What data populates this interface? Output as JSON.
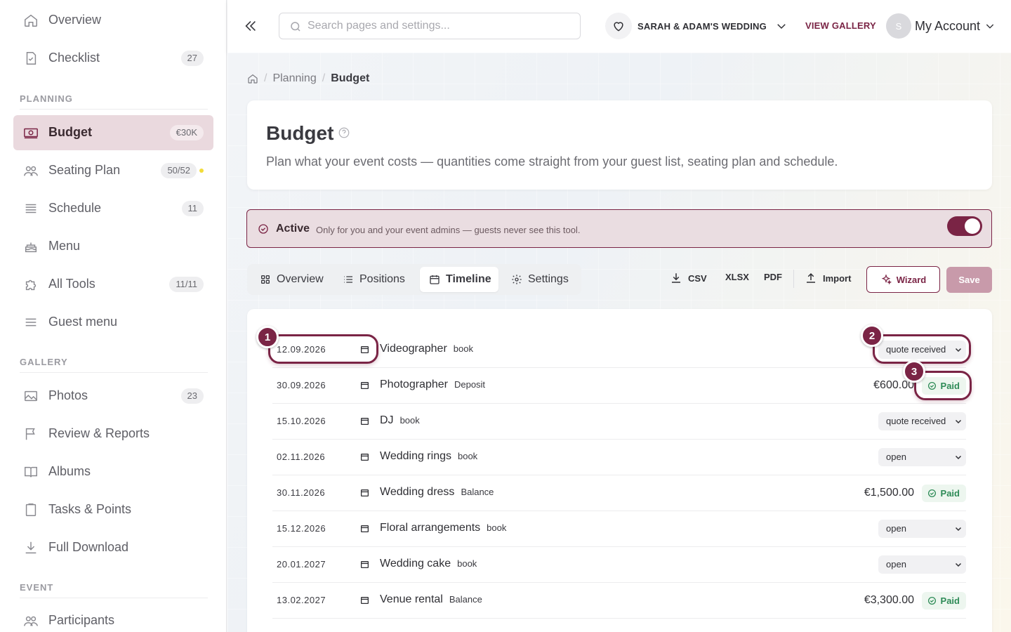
{
  "sidebar": {
    "top_items": [
      {
        "label": "Overview",
        "icon": "home-icon",
        "badge": ""
      },
      {
        "label": "Checklist",
        "icon": "checklist-icon",
        "badge": "27"
      }
    ],
    "planning_label": "PLANNING",
    "planning_items": [
      {
        "label": "Budget",
        "icon": "money-icon",
        "badge": "€30K"
      },
      {
        "label": "Seating Plan",
        "icon": "people-icon",
        "badge": "50/52"
      },
      {
        "label": "Schedule",
        "icon": "list-icon",
        "badge": "11"
      },
      {
        "label": "Menu",
        "icon": "cake-icon",
        "badge": ""
      },
      {
        "label": "All Tools",
        "icon": "puzzle-icon",
        "badge": "11/11"
      },
      {
        "label": "Guest menu",
        "icon": "menu-lines-icon",
        "badge": ""
      }
    ],
    "gallery_label": "GALLERY",
    "gallery_items": [
      {
        "label": "Photos",
        "icon": "image-icon",
        "badge": "23"
      },
      {
        "label": "Review & Reports",
        "icon": "flag-icon",
        "badge": ""
      },
      {
        "label": "Albums",
        "icon": "book-icon",
        "badge": ""
      },
      {
        "label": "Tasks & Points",
        "icon": "clipboard-icon",
        "badge": ""
      },
      {
        "label": "Full Download",
        "icon": "download-icon",
        "badge": ""
      }
    ],
    "event_label": "EVENT",
    "event_items": [
      {
        "label": "Participants",
        "icon": "people-icon",
        "badge": ""
      }
    ]
  },
  "topbar": {
    "search_placeholder": "Search pages and settings...",
    "event_name": "SARAH & ADAM'S WEDDING",
    "view_gallery": "VIEW GALLERY",
    "avatar_initial": "S",
    "account_label": "My Account"
  },
  "breadcrumb": {
    "section": "Planning",
    "current": "Budget"
  },
  "page": {
    "title": "Budget",
    "description": "Plan what your event costs — quantities come straight from your guest list, seating plan and schedule."
  },
  "banner": {
    "state": "Active",
    "note": "Only for you and your event admins — guests never see this tool.",
    "toggle_on": true
  },
  "tabs": [
    {
      "label": "Overview",
      "icon": "grid-icon"
    },
    {
      "label": "Positions",
      "icon": "list-icon"
    },
    {
      "label": "Timeline",
      "icon": "calendar-icon"
    },
    {
      "label": "Settings",
      "icon": "gear-icon"
    }
  ],
  "active_tab": "Timeline",
  "actions": {
    "csv": "CSV",
    "xlsx": "XLSX",
    "pdf": "PDF",
    "import": "Import",
    "wizard": "Wizard",
    "save": "Save"
  },
  "timeline": [
    {
      "date": "12.09.2026",
      "item": "Videographer",
      "kind": "book",
      "amount": "",
      "status": "quote received"
    },
    {
      "date": "30.09.2026",
      "item": "Photographer",
      "kind": "Deposit",
      "amount": "€600.00",
      "status": "Paid"
    },
    {
      "date": "15.10.2026",
      "item": "DJ",
      "kind": "book",
      "amount": "",
      "status": "quote received"
    },
    {
      "date": "02.11.2026",
      "item": "Wedding rings",
      "kind": "book",
      "amount": "",
      "status": "open"
    },
    {
      "date": "30.11.2026",
      "item": "Wedding dress",
      "kind": "Balance",
      "amount": "€1,500.00",
      "status": "Paid"
    },
    {
      "date": "15.12.2026",
      "item": "Floral arrangements",
      "kind": "book",
      "amount": "",
      "status": "open"
    },
    {
      "date": "20.01.2027",
      "item": "Wedding cake",
      "kind": "book",
      "amount": "",
      "status": "open"
    },
    {
      "date": "13.02.2027",
      "item": "Venue rental",
      "kind": "Balance",
      "amount": "€3,300.00",
      "status": "Paid"
    }
  ],
  "steps": [
    "1",
    "2",
    "3"
  ],
  "colors": {
    "accent": "#7a2445",
    "paid": "#2e8b57",
    "active_bg": "#ead9de"
  }
}
